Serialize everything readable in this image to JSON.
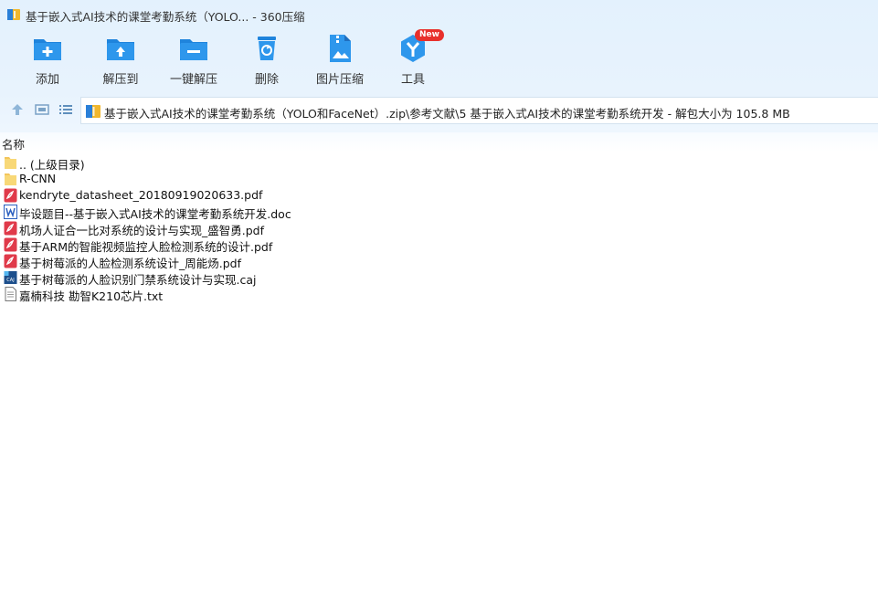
{
  "window": {
    "title": "基于嵌入式AI技术的课堂考勤系统（YOLO... - 360压缩"
  },
  "toolbar": {
    "items": [
      {
        "label": "添加",
        "icon": "add-folder-icon"
      },
      {
        "label": "解压到",
        "icon": "extract-to-folder-icon"
      },
      {
        "label": "一键解压",
        "icon": "one-click-extract-icon"
      },
      {
        "label": "删除",
        "icon": "trash-icon"
      },
      {
        "label": "图片压缩",
        "icon": "image-compress-icon"
      },
      {
        "label": "工具",
        "icon": "tools-icon",
        "badge": "New"
      }
    ]
  },
  "nav": {
    "path": "基于嵌入式AI技术的课堂考勤系统（YOLO和FaceNet）.zip\\参考文献\\5 基于嵌入式AI技术的课堂考勤系统开发 - 解包大小为 105.8 MB"
  },
  "list": {
    "column_name": "名称",
    "files": [
      {
        "name": ".. (上级目录)",
        "type": "folder"
      },
      {
        "name": "R-CNN",
        "type": "folder"
      },
      {
        "name": "kendryte_datasheet_20180919020633.pdf",
        "type": "pdf"
      },
      {
        "name": "毕设题目--基于嵌入式AI技术的课堂考勤系统开发.doc",
        "type": "doc"
      },
      {
        "name": "机场人证合一比对系统的设计与实现_盛智勇.pdf",
        "type": "pdf"
      },
      {
        "name": "基于ARM的智能视频监控人脸检测系统的设计.pdf",
        "type": "pdf"
      },
      {
        "name": "基于树莓派的人脸检测系统设计_周能炀.pdf",
        "type": "pdf"
      },
      {
        "name": "基于树莓派的人脸识别门禁系统设计与实现.caj",
        "type": "caj"
      },
      {
        "name": "嘉楠科技 勘智K210芯片.txt",
        "type": "txt"
      }
    ]
  },
  "colors": {
    "accent": "#2a8ee6",
    "pdf": "#e03a4a",
    "doc": "#2b5fbf",
    "folder": "#f6cf6a"
  }
}
